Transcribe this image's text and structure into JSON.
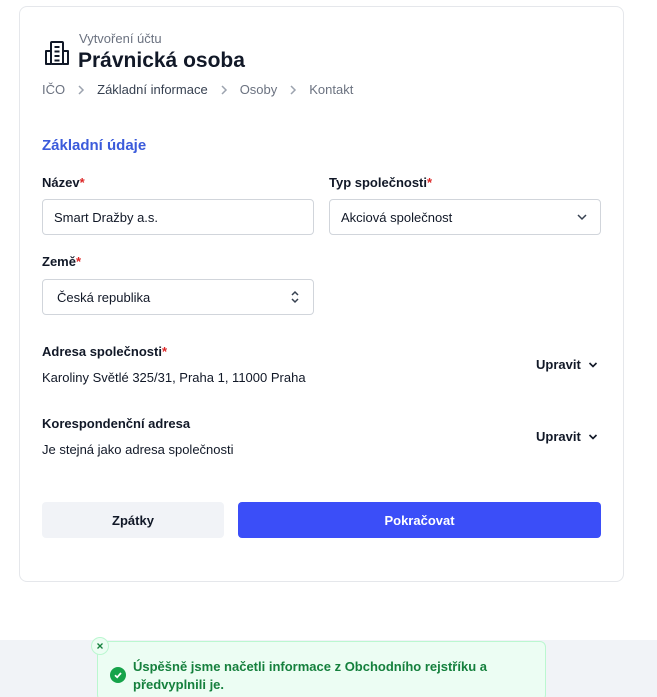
{
  "header": {
    "eyebrow": "Vytvoření účtu",
    "title": "Právnická osoba",
    "icon": "building-icon"
  },
  "breadcrumb": [
    {
      "label": "IČO",
      "active": false
    },
    {
      "label": "Základní informace",
      "active": true
    },
    {
      "label": "Osoby",
      "active": false
    },
    {
      "label": "Kontakt",
      "active": false
    }
  ],
  "form": {
    "section_title": "Základní údaje",
    "name": {
      "label": "Název",
      "required_mark": "*",
      "value": "Smart Dražby a.s."
    },
    "company_type": {
      "label": "Typ společnosti",
      "required_mark": "*",
      "value": "Akciová společnost"
    },
    "country": {
      "label": "Země",
      "required_mark": "*",
      "value": "Česká republika"
    },
    "company_address": {
      "label": "Adresa společnosti",
      "required_mark": "*",
      "value": "Karoliny Světlé 325/31, Praha 1, 11000 Praha",
      "edit_label": "Upravit"
    },
    "correspondence_address": {
      "label": "Korespondenční adresa",
      "value": "Je stejná jako adresa společnosti",
      "edit_label": "Upravit"
    }
  },
  "actions": {
    "back_label": "Zpátky",
    "continue_label": "Pokračovat"
  },
  "toast": {
    "message": "Úspěšně jsme načetli informace z Obchodního rejstříku a předvyplnili je.",
    "type": "success"
  },
  "colors": {
    "accent": "#3b4ef8",
    "section_title": "#3b5bdb",
    "required": "#dc2626",
    "success": "#16a34a"
  }
}
